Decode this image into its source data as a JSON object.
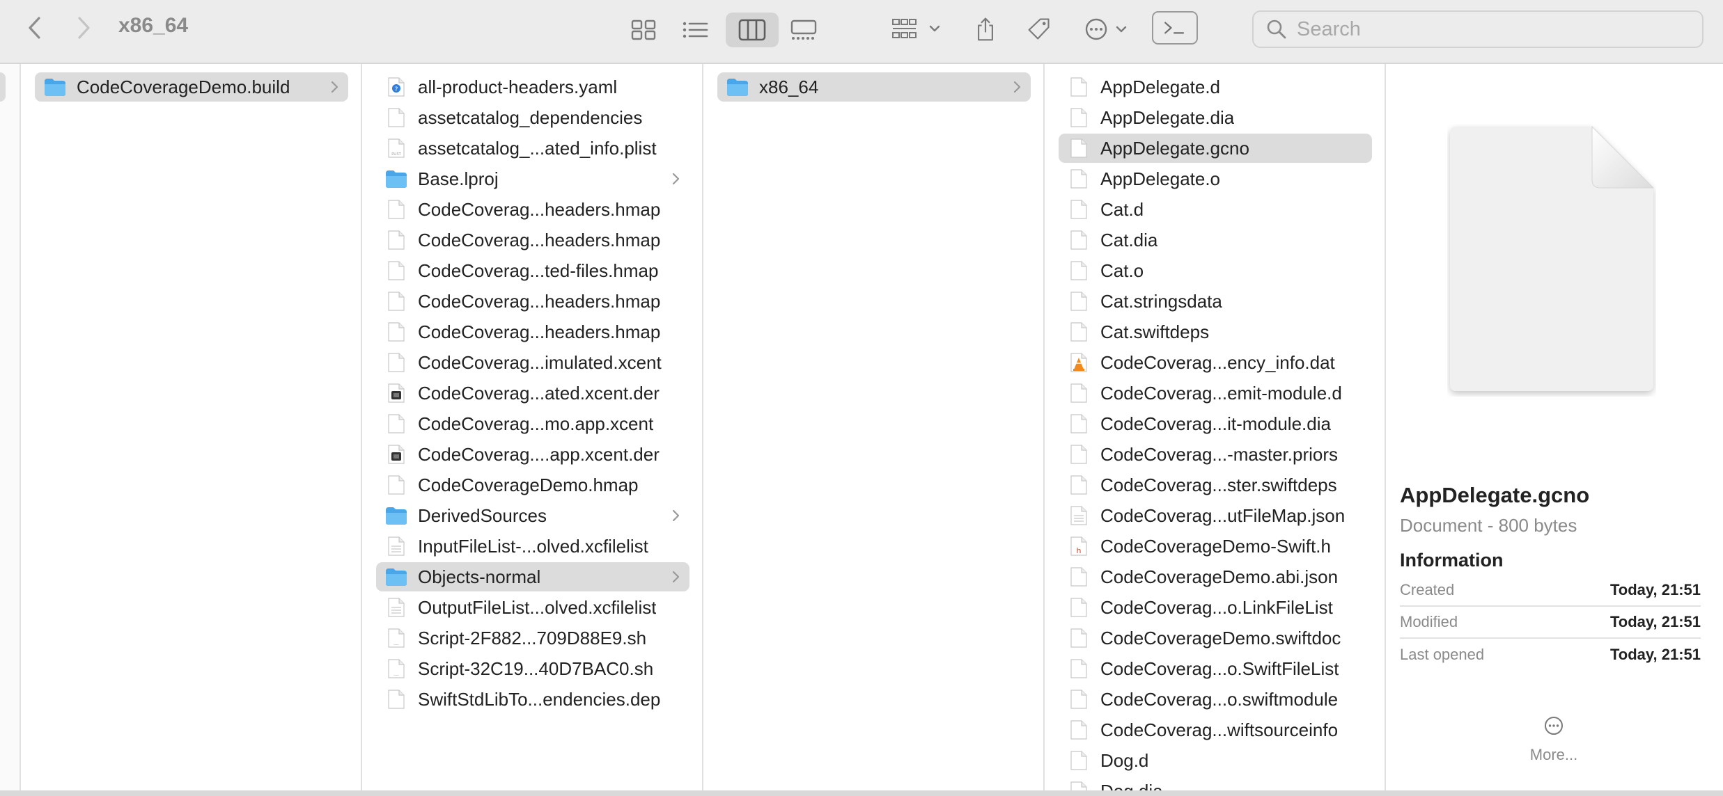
{
  "toolbar": {
    "title": "x86_64",
    "back_icon": "chevron-left-icon",
    "forward_icon": "chevron-right-icon",
    "views": [
      "icon-view",
      "list-view",
      "column-view",
      "gallery-view"
    ],
    "active_view": "column-view",
    "search_placeholder": "Search"
  },
  "columns": [
    {
      "items": [
        {
          "label": "CodeCoverageDemo.build",
          "type": "folder",
          "has_children": true,
          "selected": true
        }
      ]
    },
    {
      "items": [
        {
          "label": "all-product-headers.yaml",
          "type": "yaml"
        },
        {
          "label": "assetcatalog_dependencies",
          "type": "doc"
        },
        {
          "label": "assetcatalog_...ated_info.plist",
          "type": "plist"
        },
        {
          "label": "Base.lproj",
          "type": "folder",
          "has_children": true
        },
        {
          "label": "CodeCoverag...headers.hmap",
          "type": "doc"
        },
        {
          "label": "CodeCoverag...headers.hmap",
          "type": "doc"
        },
        {
          "label": "CodeCoverag...ted-files.hmap",
          "type": "doc"
        },
        {
          "label": "CodeCoverag...headers.hmap",
          "type": "doc"
        },
        {
          "label": "CodeCoverag...headers.hmap",
          "type": "doc"
        },
        {
          "label": "CodeCoverag...imulated.xcent",
          "type": "doc"
        },
        {
          "label": "CodeCoverag...ated.xcent.der",
          "type": "exec"
        },
        {
          "label": "CodeCoverag...mo.app.xcent",
          "type": "doc"
        },
        {
          "label": "CodeCoverag....app.xcent.der",
          "type": "exec"
        },
        {
          "label": "CodeCoverageDemo.hmap",
          "type": "doc"
        },
        {
          "label": "DerivedSources",
          "type": "folder",
          "has_children": true
        },
        {
          "label": "InputFileList-...olved.xcfilelist",
          "type": "text"
        },
        {
          "label": "Objects-normal",
          "type": "folder",
          "has_children": true,
          "selected": true
        },
        {
          "label": "OutputFileList...olved.xcfilelist",
          "type": "text"
        },
        {
          "label": "Script-2F882...709D88E9.sh",
          "type": "script"
        },
        {
          "label": "Script-32C19...40D7BAC0.sh",
          "type": "script"
        },
        {
          "label": "SwiftStdLibTo...endencies.dep",
          "type": "doc"
        }
      ]
    },
    {
      "items": [
        {
          "label": "x86_64",
          "type": "folder",
          "has_children": true,
          "selected": true
        }
      ]
    },
    {
      "items": [
        {
          "label": "AppDelegate.d",
          "type": "doc"
        },
        {
          "label": "AppDelegate.dia",
          "type": "doc"
        },
        {
          "label": "AppDelegate.gcno",
          "type": "doc",
          "selected": true
        },
        {
          "label": "AppDelegate.o",
          "type": "doc"
        },
        {
          "label": "Cat.d",
          "type": "doc"
        },
        {
          "label": "Cat.dia",
          "type": "doc"
        },
        {
          "label": "Cat.o",
          "type": "doc"
        },
        {
          "label": "Cat.stringsdata",
          "type": "doc"
        },
        {
          "label": "Cat.swiftdeps",
          "type": "doc"
        },
        {
          "label": "CodeCoverag...ency_info.dat",
          "type": "vlc"
        },
        {
          "label": "CodeCoverag...emit-module.d",
          "type": "doc"
        },
        {
          "label": "CodeCoverag...it-module.dia",
          "type": "doc"
        },
        {
          "label": "CodeCoverag...-master.priors",
          "type": "doc"
        },
        {
          "label": "CodeCoverag...ster.swiftdeps",
          "type": "doc"
        },
        {
          "label": "CodeCoverag...utFileMap.json",
          "type": "text"
        },
        {
          "label": "CodeCoverageDemo-Swift.h",
          "type": "header"
        },
        {
          "label": "CodeCoverageDemo.abi.json",
          "type": "doc"
        },
        {
          "label": "CodeCoverag...o.LinkFileList",
          "type": "doc"
        },
        {
          "label": "CodeCoverageDemo.swiftdoc",
          "type": "doc"
        },
        {
          "label": "CodeCoverag...o.SwiftFileList",
          "type": "doc"
        },
        {
          "label": "CodeCoverag...o.swiftmodule",
          "type": "doc"
        },
        {
          "label": "CodeCoverag...wiftsourceinfo",
          "type": "doc"
        },
        {
          "label": "Dog.d",
          "type": "doc"
        },
        {
          "label": "Dog.dia",
          "type": "doc"
        }
      ]
    }
  ],
  "preview": {
    "icon": "document-icon",
    "name": "AppDelegate.gcno",
    "kind": "Document - 800 bytes",
    "info_heading": "Information",
    "info": [
      {
        "key": "Created",
        "value": "Today, 21:51"
      },
      {
        "key": "Modified",
        "value": "Today, 21:51"
      },
      {
        "key": "Last opened",
        "value": "Today, 21:51"
      }
    ],
    "more_label": "More..."
  },
  "colors": {
    "folder": "#5bb5ee",
    "selection": "#dcdcdc",
    "toolbar_bg": "#ececec"
  }
}
